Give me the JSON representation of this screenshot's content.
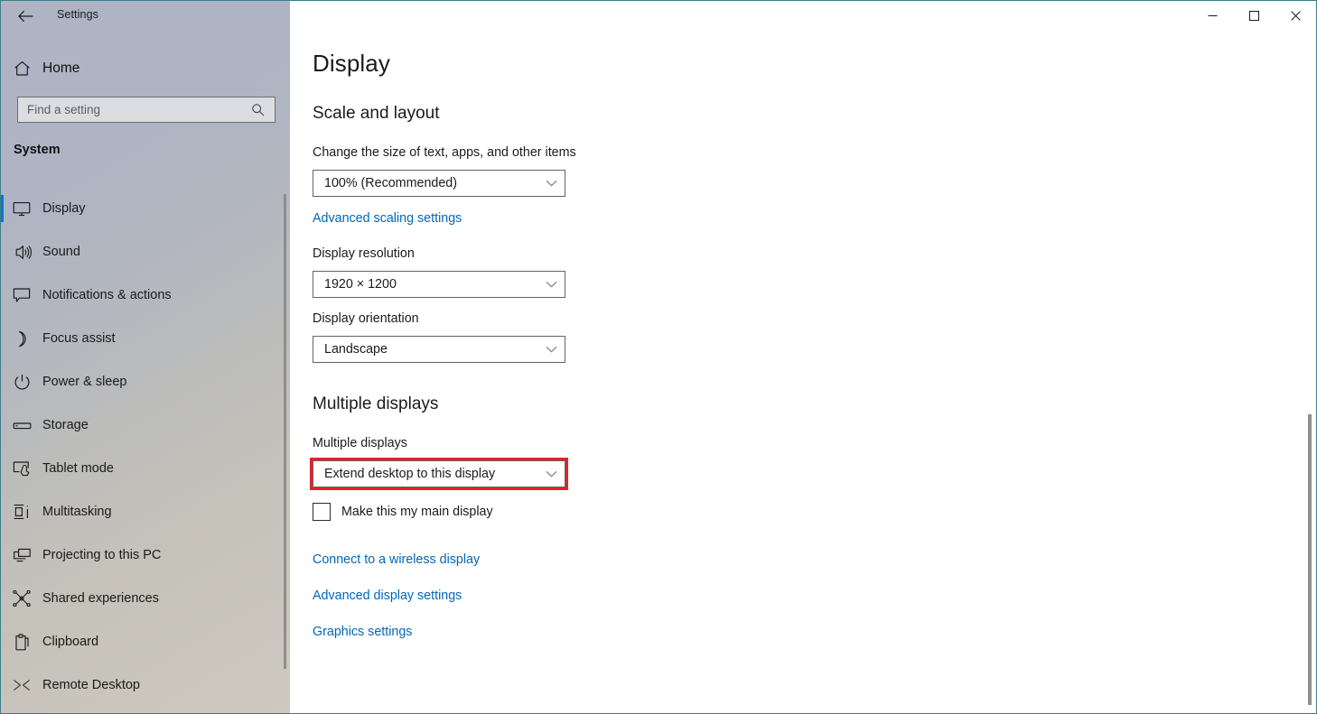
{
  "window": {
    "app_title": "Settings",
    "back_icon": "back-arrow-icon",
    "controls": {
      "minimize": "minimize-icon",
      "maximize": "maximize-icon",
      "close": "close-icon"
    }
  },
  "sidebar": {
    "home": {
      "label": "Home",
      "icon": "home-icon"
    },
    "search": {
      "placeholder": "Find a setting",
      "value": "",
      "icon": "search-icon"
    },
    "category": "System",
    "items": [
      {
        "label": "Display",
        "icon": "monitor-icon",
        "selected": true
      },
      {
        "label": "Sound",
        "icon": "speaker-icon",
        "selected": false
      },
      {
        "label": "Notifications & actions",
        "icon": "notification-icon",
        "selected": false
      },
      {
        "label": "Focus assist",
        "icon": "moon-icon",
        "selected": false
      },
      {
        "label": "Power & sleep",
        "icon": "power-icon",
        "selected": false
      },
      {
        "label": "Storage",
        "icon": "storage-icon",
        "selected": false
      },
      {
        "label": "Tablet mode",
        "icon": "tablet-icon",
        "selected": false
      },
      {
        "label": "Multitasking",
        "icon": "multitasking-icon",
        "selected": false
      },
      {
        "label": "Projecting to this PC",
        "icon": "projecting-icon",
        "selected": false
      },
      {
        "label": "Shared experiences",
        "icon": "share-nodes-icon",
        "selected": false
      },
      {
        "label": "Clipboard",
        "icon": "clipboard-icon",
        "selected": false
      },
      {
        "label": "Remote Desktop",
        "icon": "remote-desktop-icon",
        "selected": false
      }
    ]
  },
  "main": {
    "page_title": "Display",
    "sections": {
      "scale_and_layout": {
        "heading": "Scale and layout",
        "scale_label": "Change the size of text, apps, and other items",
        "scale_value": "100% (Recommended)",
        "advanced_scaling_link": "Advanced scaling settings",
        "resolution_label": "Display resolution",
        "resolution_value": "1920 × 1200",
        "orientation_label": "Display orientation",
        "orientation_value": "Landscape"
      },
      "multiple_displays": {
        "heading": "Multiple displays",
        "mode_label": "Multiple displays",
        "mode_value": "Extend desktop to this display",
        "main_display_checkbox_label": "Make this my main display",
        "main_display_checked": false,
        "links": [
          "Connect to a wireless display",
          "Advanced display settings",
          "Graphics settings"
        ]
      }
    }
  },
  "colors": {
    "accent": "#0078d7",
    "link": "#0067b8",
    "highlight_box": "#e0232c",
    "sidebar_top": "#aeb4c4",
    "sidebar_bottom": "#cdc9c0"
  }
}
